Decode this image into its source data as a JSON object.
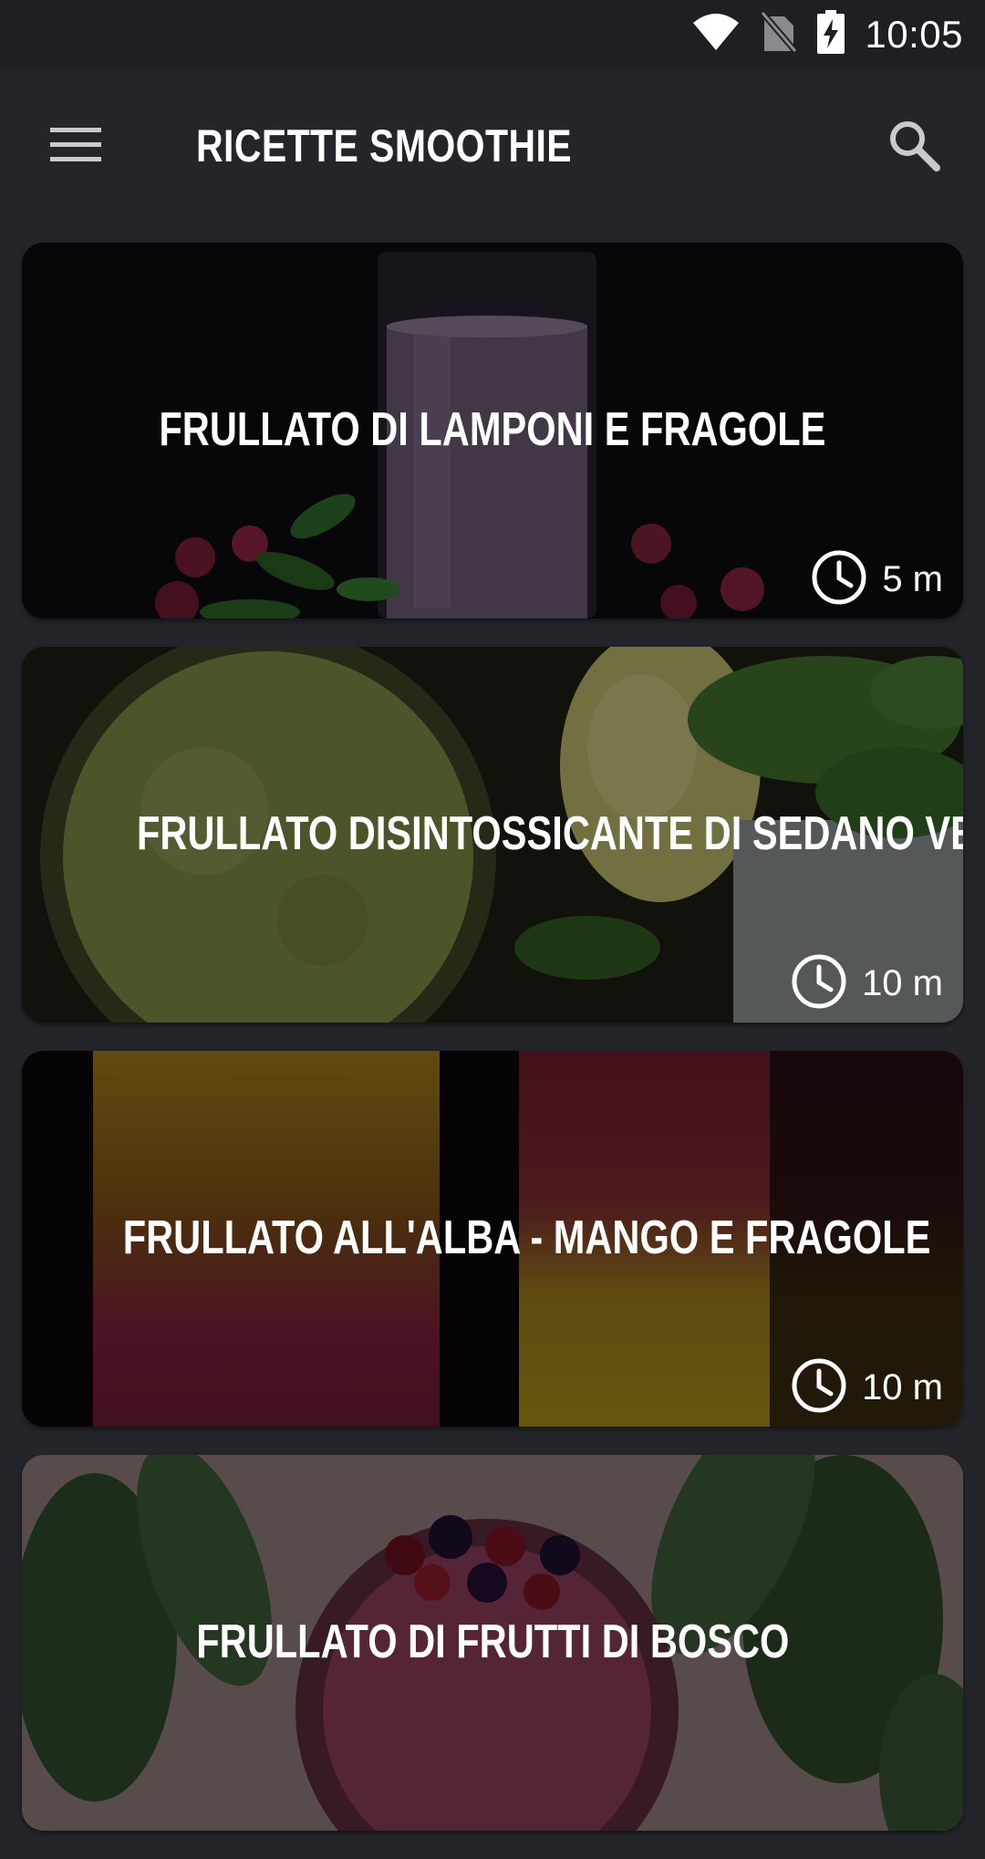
{
  "status_bar": {
    "time": "10:05",
    "icons": [
      "wifi-icon",
      "no-sim-icon",
      "battery-charging-icon"
    ]
  },
  "app_bar": {
    "title": "RICETTE SMOOTHIE",
    "menu_icon": "hamburger-menu-icon",
    "search_icon": "search-icon"
  },
  "recipes": [
    {
      "title": "FRULLATO DI LAMPONI E FRAGOLE",
      "time": "5 m",
      "time_icon": "clock-icon"
    },
    {
      "title": "FRULLATO DISINTOSSICANTE DI SEDANO VERDE",
      "time": "10 m",
      "time_icon": "clock-icon"
    },
    {
      "title": "FRULLATO ALL'ALBA - MANGO E FRAGOLE",
      "time": "10 m",
      "time_icon": "clock-icon"
    },
    {
      "title": "FRULLATO DI FRUTTI DI BOSCO",
      "time": "",
      "time_icon": "clock-icon"
    }
  ],
  "colors": {
    "background": "#24252b",
    "status_bar": "#1e1f23",
    "text": "#ffffff"
  }
}
